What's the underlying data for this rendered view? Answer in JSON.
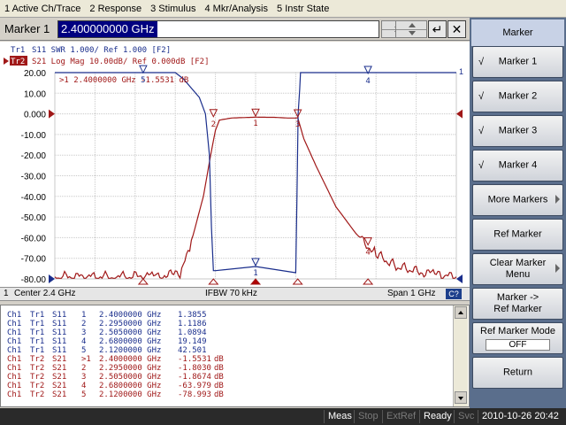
{
  "menu": [
    "1 Active Ch/Trace",
    "2 Response",
    "3 Stimulus",
    "4 Mkr/Analysis",
    "5 Instr State"
  ],
  "entry": {
    "title": "Marker 1",
    "value": "2.400000000 GHz",
    "enter_glyph": "↵",
    "close_glyph": "✕"
  },
  "trace_labels": {
    "tr1": {
      "name": "Tr1",
      "text": "S11  SWR 1.000/ Ref 1.000 [F2]"
    },
    "tr2": {
      "name": "Tr2",
      "text": "S21  Log Mag 10.00dB/ Ref 0.000dB [F2]"
    }
  },
  "active_marker_readout": ">1   2.4000000 GHz  -1.5531 dB",
  "chart_data": {
    "type": "line",
    "y_ticks": [
      "20.00",
      "10.00",
      "0.000",
      "-10.00",
      "-20.00",
      "-30.00",
      "-40.00",
      "-50.00",
      "-60.00",
      "-70.00",
      "-80.00"
    ],
    "ylim": [
      -80,
      20
    ],
    "xlim": [
      1.9,
      2.9
    ],
    "ref_level": 0,
    "grid": true,
    "series": [
      {
        "name": "S21",
        "color": "#a01818",
        "x": [
          1.9,
          2.05,
          2.15,
          2.2,
          2.212,
          2.24,
          2.27,
          2.29,
          2.3,
          2.31,
          2.34,
          2.4,
          2.45,
          2.48,
          2.5,
          2.505,
          2.52,
          2.55,
          2.6,
          2.65,
          2.68,
          2.7,
          2.75,
          2.8,
          2.85,
          2.9
        ],
        "y": [
          -79,
          -79,
          -78.5,
          -78,
          -79,
          -62,
          -40,
          -18,
          -8,
          -3,
          -2,
          -1.6,
          -1.7,
          -2,
          -2,
          -1.9,
          -12,
          -25,
          -45,
          -58,
          -64,
          -68,
          -74,
          -76,
          -78,
          -79
        ]
      },
      {
        "name": "S11",
        "color": "#1a2e8c",
        "x": [
          1.9,
          2.2,
          2.22,
          2.26,
          2.275,
          2.285,
          2.29,
          2.295,
          2.3,
          2.4,
          2.5,
          2.503,
          2.506,
          2.51,
          2.512,
          2.9
        ],
        "y": [
          20,
          20,
          17,
          8,
          0,
          -20,
          -55,
          -76,
          -76,
          -74,
          -77,
          -40,
          0,
          12,
          20,
          20
        ]
      }
    ],
    "markers": [
      {
        "id": "1",
        "trace": "S21",
        "x": 2.4,
        "y": -1.5531
      },
      {
        "id": "2",
        "trace": "S21",
        "x": 2.295,
        "y": -1.803
      },
      {
        "id": "3",
        "trace": "S21",
        "x": 2.505,
        "y": -1.8674
      },
      {
        "id": "4",
        "trace": "S21",
        "x": 2.68,
        "y": -63.979
      },
      {
        "id": "1",
        "trace": "S11",
        "x": 2.4,
        "y": -74
      },
      {
        "id": "4",
        "trace": "S11",
        "x": 2.68,
        "y": 19.149
      },
      {
        "id": "5",
        "trace": "S11",
        "x": 2.12,
        "y": 19.5
      }
    ],
    "channel_label": "1",
    "trace_end_label": "1"
  },
  "chart_status": {
    "channel": "1",
    "center": "Center 2.4 GHz",
    "ifbw": "IFBW 70 kHz",
    "span": "Span 1 GHz",
    "cal": "C?"
  },
  "marker_table": [
    {
      "ch": "Ch1",
      "tr": "Tr1",
      "param": "S11",
      "num": "1",
      "freq": "2.4000000 GHz",
      "value": "1.3855",
      "unit": ""
    },
    {
      "ch": "Ch1",
      "tr": "Tr1",
      "param": "S11",
      "num": "2",
      "freq": "2.2950000 GHz",
      "value": "1.1186",
      "unit": ""
    },
    {
      "ch": "Ch1",
      "tr": "Tr1",
      "param": "S11",
      "num": "3",
      "freq": "2.5050000 GHz",
      "value": "1.0894",
      "unit": ""
    },
    {
      "ch": "Ch1",
      "tr": "Tr1",
      "param": "S11",
      "num": "4",
      "freq": "2.6800000 GHz",
      "value": "19.149",
      "unit": ""
    },
    {
      "ch": "Ch1",
      "tr": "Tr1",
      "param": "S11",
      "num": "5",
      "freq": "2.1200000 GHz",
      "value": "42.501",
      "unit": ""
    },
    {
      "ch": "Ch1",
      "tr": "Tr2",
      "param": "S21",
      "num": ">1",
      "freq": "2.4000000 GHz",
      "value": "-1.5531",
      "unit": "dB"
    },
    {
      "ch": "Ch1",
      "tr": "Tr2",
      "param": "S21",
      "num": "2",
      "freq": "2.2950000 GHz",
      "value": "-1.8030",
      "unit": "dB"
    },
    {
      "ch": "Ch1",
      "tr": "Tr2",
      "param": "S21",
      "num": "3",
      "freq": "2.5050000 GHz",
      "value": "-1.8674",
      "unit": "dB"
    },
    {
      "ch": "Ch1",
      "tr": "Tr2",
      "param": "S21",
      "num": "4",
      "freq": "2.6800000 GHz",
      "value": "-63.979",
      "unit": "dB"
    },
    {
      "ch": "Ch1",
      "tr": "Tr2",
      "param": "S21",
      "num": "5",
      "freq": "2.1200000 GHz",
      "value": "-78.993",
      "unit": "dB"
    }
  ],
  "status_bar": {
    "meas": "Meas",
    "stop": "Stop",
    "extref": "ExtRef",
    "ready": "Ready",
    "svc": "Svc",
    "datetime": "2010-10-26 20:42"
  },
  "softkeys": {
    "header": "Marker",
    "items": [
      {
        "label": "Marker 1",
        "checked": true,
        "check_glyph": "√"
      },
      {
        "label": "Marker 2",
        "checked": true,
        "check_glyph": "√"
      },
      {
        "label": "Marker 3",
        "checked": true,
        "check_glyph": "√"
      },
      {
        "label": "Marker 4",
        "checked": true,
        "check_glyph": "√"
      },
      {
        "label": "More Markers"
      },
      {
        "label": "Ref Marker"
      },
      {
        "label": "Clear Marker Menu"
      },
      {
        "label": "Marker -> Ref Marker"
      },
      {
        "label": "Ref Marker Mode",
        "value": "OFF"
      },
      {
        "label": "Return"
      }
    ]
  },
  "colors": {
    "s11": "#1a2e8c",
    "s21": "#a01818",
    "grid": "#c8c8c8",
    "active_marker": "#b00000",
    "tr2_badge_bg": "#a01818"
  }
}
